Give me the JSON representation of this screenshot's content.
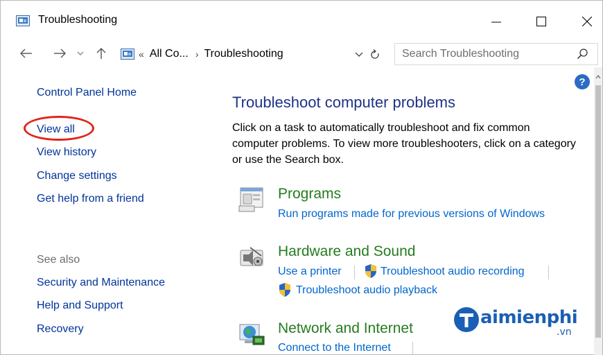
{
  "window": {
    "title": "Troubleshooting",
    "controls": {
      "minimize": "minimize",
      "maximize": "maximize",
      "close": "close"
    }
  },
  "address": {
    "overflow": "«",
    "crumb_parent": "All Co...",
    "separator": "›",
    "crumb_current": "Troubleshooting",
    "search_placeholder": "Search Troubleshooting"
  },
  "left_pane": {
    "home": "Control Panel Home",
    "links": [
      "View all",
      "View history",
      "Change settings",
      "Get help from a friend"
    ],
    "see_also_label": "See also",
    "see_also": [
      "Security and Maintenance",
      "Help and Support",
      "Recovery"
    ]
  },
  "main": {
    "heading": "Troubleshoot computer problems",
    "intro": "Click on a task to automatically troubleshoot and fix common computer problems. To view more troubleshooters, click on a category or use the Search box.",
    "categories": [
      {
        "title": "Programs",
        "icon": "programs-icon",
        "links": [
          "Run programs made for previous versions of Windows"
        ]
      },
      {
        "title": "Hardware and Sound",
        "icon": "hardware-sound-icon",
        "links": [
          "Use a printer",
          "Troubleshoot audio recording",
          "Troubleshoot audio playback"
        ]
      },
      {
        "title": "Network and Internet",
        "icon": "network-icon",
        "links": [
          "Connect to the Internet"
        ]
      }
    ]
  },
  "help": {
    "label": "?"
  },
  "watermark": {
    "brand": "aimienphi",
    "suffix": ".vn"
  },
  "colors": {
    "link": "#003399",
    "heading": "#1e3287",
    "category_title": "#267b20",
    "category_link": "#0066cc",
    "highlight_ellipse": "#e2231a"
  }
}
